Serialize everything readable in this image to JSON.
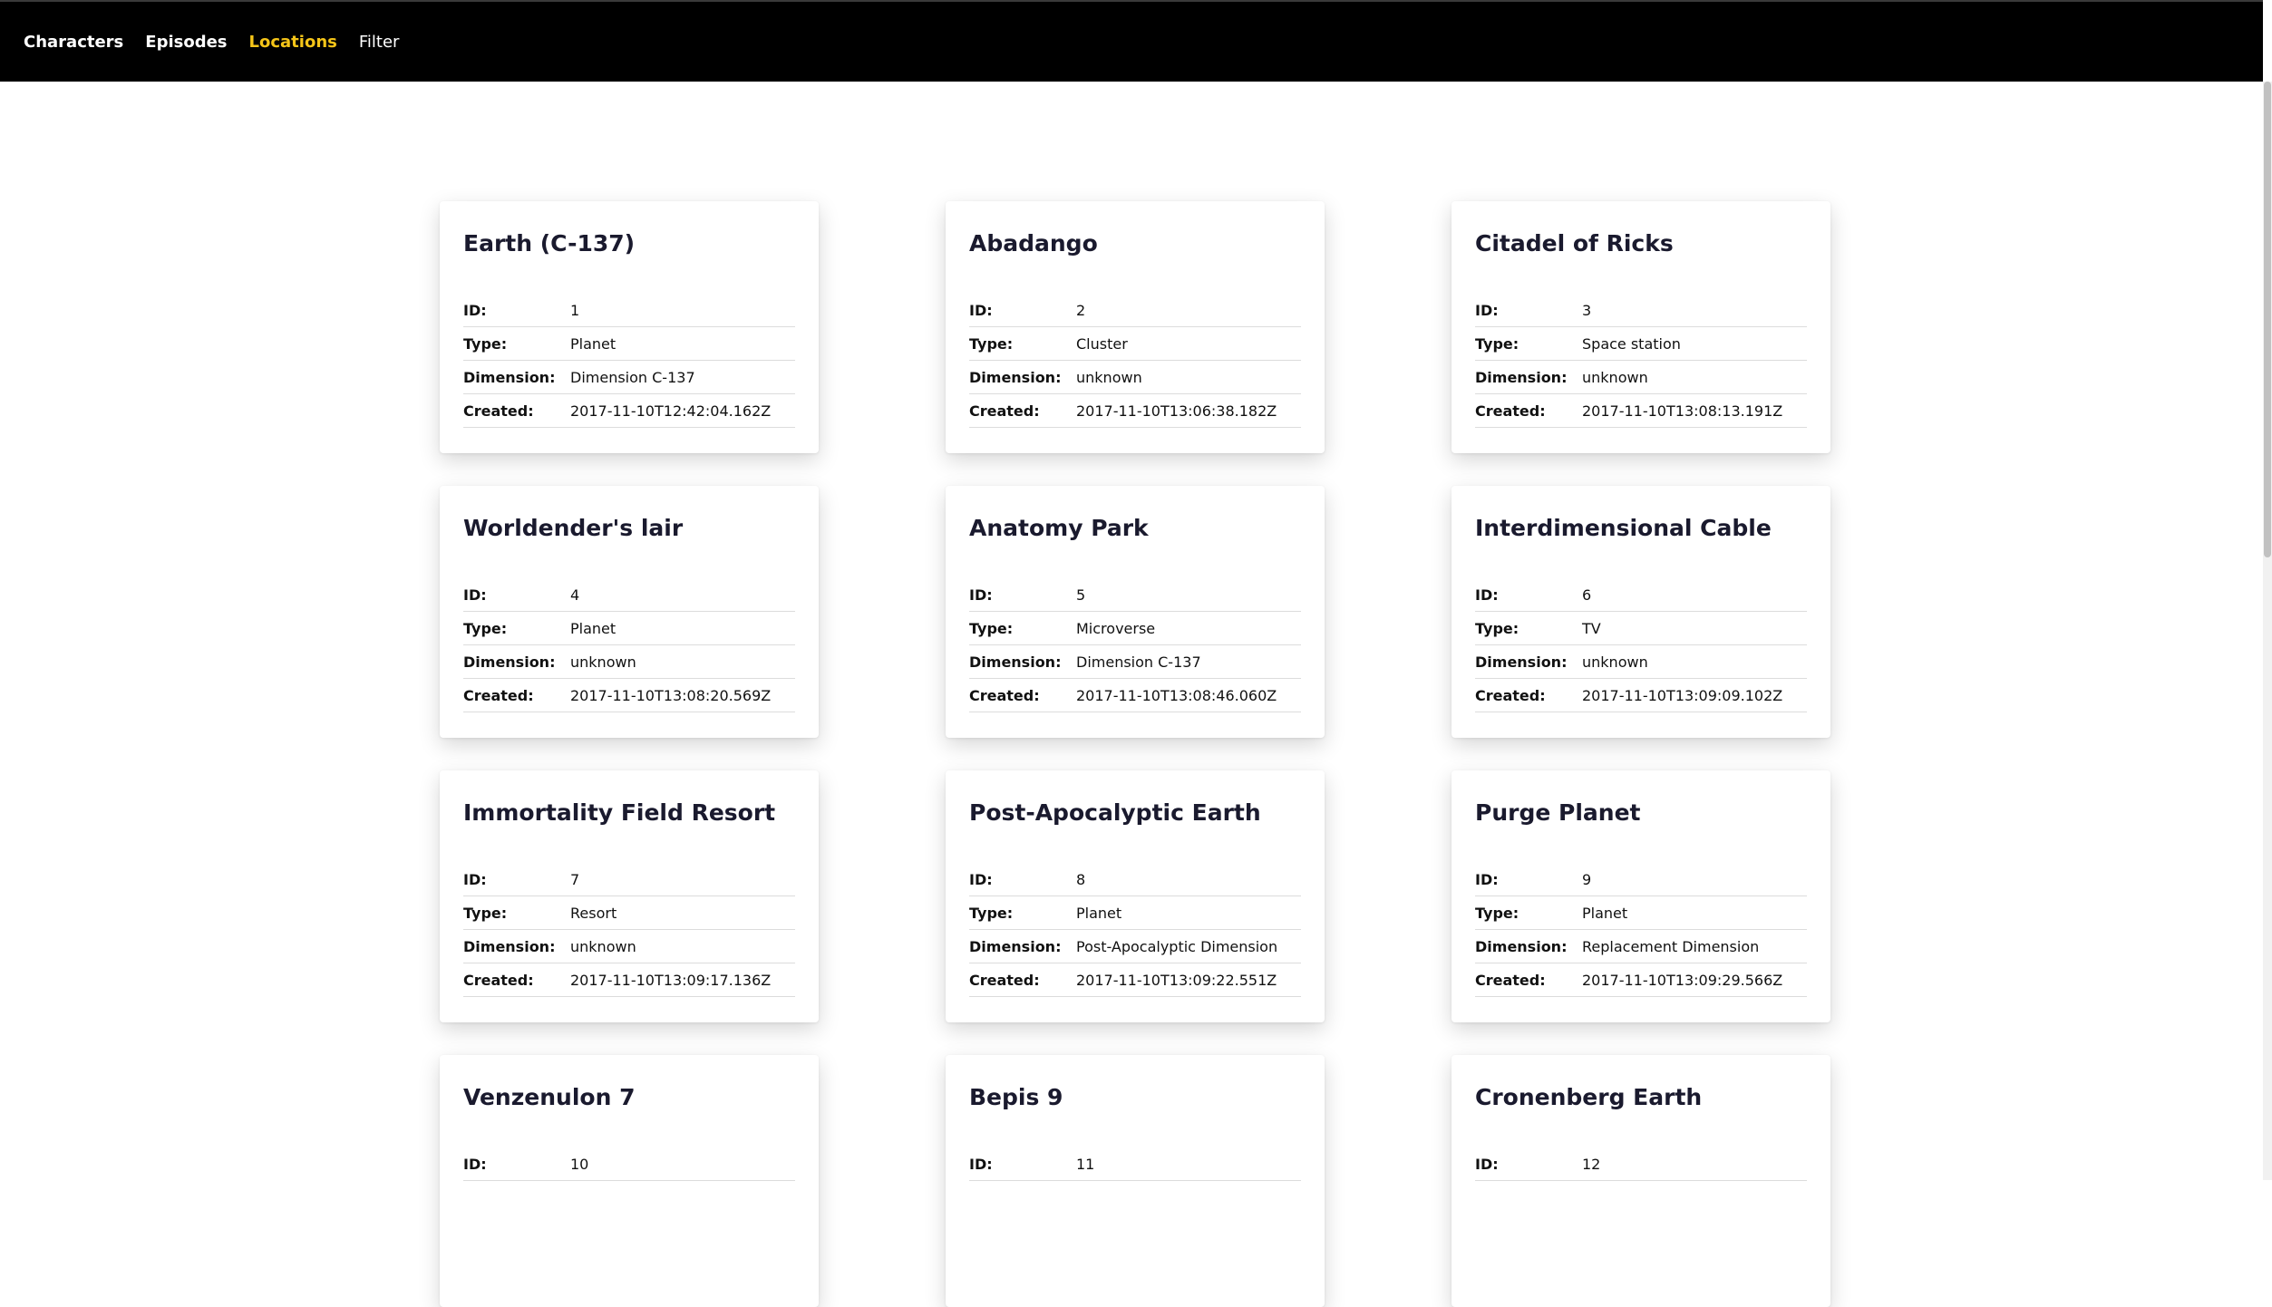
{
  "nav": {
    "items": [
      {
        "label": "Characters",
        "active": false
      },
      {
        "label": "Episodes",
        "active": false
      },
      {
        "label": "Locations",
        "active": true
      },
      {
        "label": "Filter",
        "active": false
      }
    ]
  },
  "labels": {
    "id": "ID:",
    "type": "Type:",
    "dimension": "Dimension:",
    "created": "Created:"
  },
  "cards": [
    {
      "name": "Earth (C-137)",
      "id": "1",
      "type": "Planet",
      "dimension": "Dimension C-137",
      "created": "2017-11-10T12:42:04.162Z"
    },
    {
      "name": "Abadango",
      "id": "2",
      "type": "Cluster",
      "dimension": "unknown",
      "created": "2017-11-10T13:06:38.182Z"
    },
    {
      "name": "Citadel of Ricks",
      "id": "3",
      "type": "Space station",
      "dimension": "unknown",
      "created": "2017-11-10T13:08:13.191Z"
    },
    {
      "name": "Worldender's lair",
      "id": "4",
      "type": "Planet",
      "dimension": "unknown",
      "created": "2017-11-10T13:08:20.569Z"
    },
    {
      "name": "Anatomy Park",
      "id": "5",
      "type": "Microverse",
      "dimension": "Dimension C-137",
      "created": "2017-11-10T13:08:46.060Z"
    },
    {
      "name": "Interdimensional Cable",
      "id": "6",
      "type": "TV",
      "dimension": "unknown",
      "created": "2017-11-10T13:09:09.102Z"
    },
    {
      "name": "Immortality Field Resort",
      "id": "7",
      "type": "Resort",
      "dimension": "unknown",
      "created": "2017-11-10T13:09:17.136Z"
    },
    {
      "name": "Post-Apocalyptic Earth",
      "id": "8",
      "type": "Planet",
      "dimension": "Post-Apocalyptic Dimension",
      "created": "2017-11-10T13:09:22.551Z"
    },
    {
      "name": "Purge Planet",
      "id": "9",
      "type": "Planet",
      "dimension": "Replacement Dimension",
      "created": "2017-11-10T13:09:29.566Z"
    },
    {
      "name": "Venzenulon 7",
      "id": "10"
    },
    {
      "name": "Bepis 9",
      "id": "11"
    },
    {
      "name": "Cronenberg Earth",
      "id": "12"
    }
  ]
}
